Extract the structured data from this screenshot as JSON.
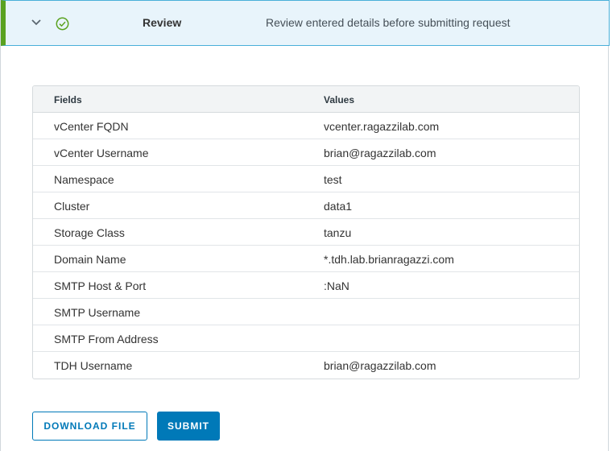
{
  "step": {
    "title": "Review",
    "description": "Review entered details before submitting request"
  },
  "table": {
    "headers": [
      "Fields",
      "Values"
    ],
    "rows": [
      [
        "vCenter FQDN",
        "vcenter.ragazzilab.com"
      ],
      [
        "vCenter Username",
        "brian@ragazzilab.com"
      ],
      [
        "Namespace",
        "test"
      ],
      [
        "Cluster",
        "data1"
      ],
      [
        "Storage Class",
        "tanzu"
      ],
      [
        "Domain Name",
        "*.tdh.lab.brianragazzi.com"
      ],
      [
        "SMTP Host & Port",
        ":NaN"
      ],
      [
        "SMTP Username",
        ""
      ],
      [
        "SMTP From Address",
        ""
      ],
      [
        "TDH Username",
        "brian@ragazzilab.com"
      ]
    ]
  },
  "actions": {
    "download_label": "DOWNLOAD FILE",
    "submit_label": "SUBMIT"
  },
  "colors": {
    "accent": "#0079b8",
    "success": "#5aa220",
    "header_bg": "#e8f4fb"
  },
  "icons": {
    "toggle": "chevron-down-icon",
    "status": "check-circle-icon"
  }
}
